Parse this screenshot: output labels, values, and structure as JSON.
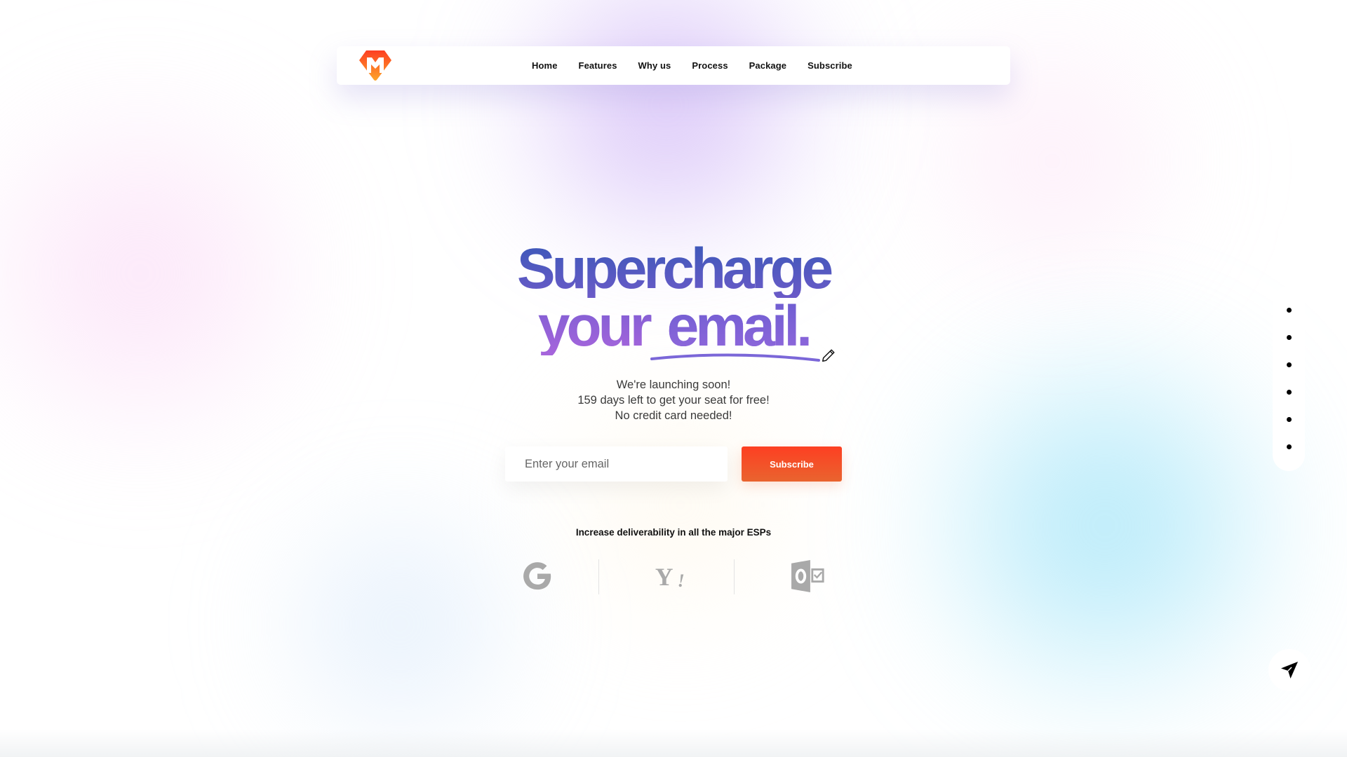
{
  "brand": {
    "logo_icon": "hexagon-m-logo-icon",
    "colors": {
      "logo_top": "#fd3f22",
      "logo_bottom": "#fda52a",
      "accent": "#fd3f22"
    }
  },
  "nav": {
    "items": [
      {
        "label": "Home"
      },
      {
        "label": "Features"
      },
      {
        "label": "Why us"
      },
      {
        "label": "Process"
      },
      {
        "label": "Package"
      },
      {
        "label": "Subscribe"
      }
    ]
  },
  "hero": {
    "title_line1": "Supercharge",
    "title_line2_a": "your",
    "title_line2_b": "email.",
    "underline_color": "#7b67d8",
    "pencil_icon": "pencil-icon",
    "subtext": [
      "We're launching soon!",
      "159 days left to get your seat for free!",
      "No credit card needed!"
    ]
  },
  "signup": {
    "email_placeholder": "Enter your email",
    "email_value": "",
    "subscribe_label": "Subscribe"
  },
  "esps": {
    "caption": "Increase deliverability in all the major ESPs",
    "logos": [
      {
        "name": "Google",
        "icon": "google-icon"
      },
      {
        "name": "Yahoo",
        "icon": "yahoo-icon"
      },
      {
        "name": "Outlook",
        "icon": "outlook-icon"
      }
    ],
    "logo_color": "#a9a9a9"
  },
  "side_nav": {
    "dot_count": 6
  },
  "floating": {
    "send_icon": "paper-plane-icon"
  }
}
